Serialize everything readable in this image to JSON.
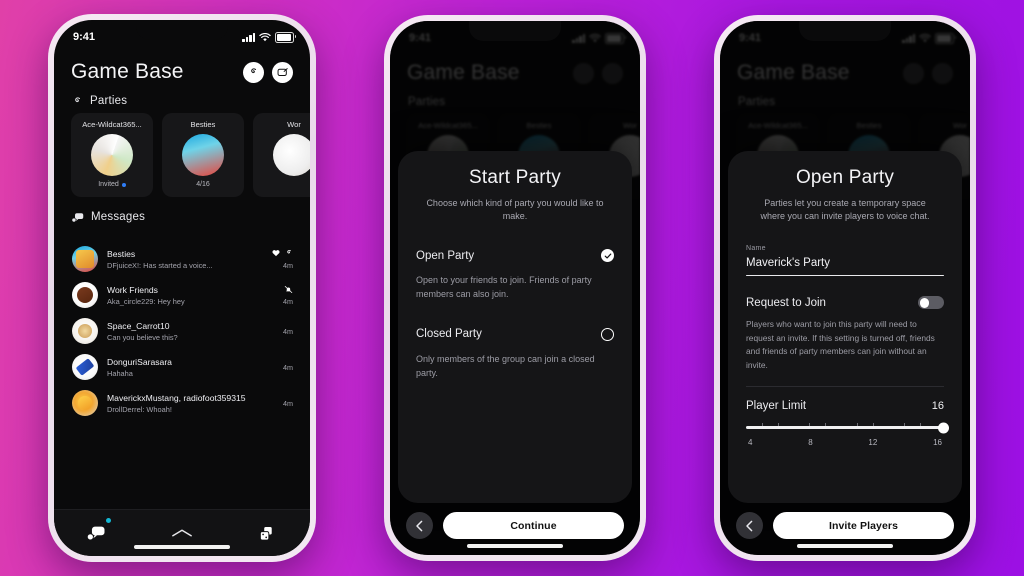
{
  "background": {
    "gradient_from": "#e040a8",
    "gradient_to": "#9c10e4"
  },
  "phones": [
    {
      "id": "phone-home",
      "status_bar": {
        "time": "9:41",
        "cellular_icon": "signal-bars-icon",
        "wifi_icon": "wifi-icon",
        "battery_icon": "battery-icon"
      },
      "header": {
        "title": "Game Base",
        "buttons": [
          {
            "name": "party-icon-button",
            "icon": "party-swirl-icon"
          },
          {
            "name": "new-message-button",
            "icon": "new-message-icon"
          }
        ]
      },
      "parties_section": {
        "icon": "party-swirl-icon",
        "title": "Parties",
        "cards": [
          {
            "name": "Ace-Wildcat365...",
            "status": "Invited",
            "has_dot": true,
            "avatar": "collage-avatar"
          },
          {
            "name": "Besties",
            "status": "4/16",
            "has_dot": false,
            "avatar": "hotdog-avatar"
          },
          {
            "name": "Wor",
            "status": "",
            "has_dot": false,
            "avatar": "dog-avatar"
          }
        ]
      },
      "messages_section": {
        "icon": "chat-bubbles-icon",
        "title": "Messages",
        "rows": [
          {
            "name": "Besties",
            "preview": "DFjuiceX!: Has started a voice...",
            "time": "4m",
            "icons": [
              "heart-icon",
              "party-swirl-icon"
            ],
            "avatar": "hotdog-avatar"
          },
          {
            "name": "Work Friends",
            "preview": "Aka_circle229: Hey hey",
            "time": "4m",
            "icons": [
              "bell-muted-icon"
            ],
            "avatar": "steak-avatar"
          },
          {
            "name": "Space_Carrot10",
            "preview": "Can you believe this?",
            "time": "4m",
            "icons": [],
            "avatar": "cat-avatar"
          },
          {
            "name": "DonguriSarasara",
            "preview": "Hahaha",
            "time": "4m",
            "icons": [],
            "avatar": "skateboard-avatar"
          },
          {
            "name": "MaverickxMustang, radiofoot359315",
            "preview": "DrollDerrel: Whoah!",
            "time": "4m",
            "icons": [],
            "avatar": "chick-avatar"
          }
        ]
      },
      "tab_bar": [
        {
          "name": "tab-messages",
          "icon": "chat-bubbles-icon",
          "badge": true
        },
        {
          "name": "tab-expand",
          "icon": "chevron-up-icon",
          "badge": false
        },
        {
          "name": "tab-games",
          "icon": "dice-icon",
          "badge": false
        }
      ]
    },
    {
      "id": "phone-start-party",
      "status_bar": {
        "time": "9:41",
        "cellular_icon": "signal-bars-icon",
        "wifi_icon": "wifi-icon",
        "battery_icon": "battery-icon"
      },
      "header": {
        "title": "Game Base"
      },
      "parties_section": {
        "title": "Parties",
        "cards": [
          {
            "name": "Ace-Wildcat365..."
          },
          {
            "name": "Besties"
          },
          {
            "name": "Wor"
          }
        ]
      },
      "sheet": {
        "title": "Start Party",
        "subtitle": "Choose which kind of party you would like to make.",
        "options": [
          {
            "label": "Open Party",
            "selected": true,
            "description": "Open to your friends to join. Friends of party members can also join."
          },
          {
            "label": "Closed Party",
            "selected": false,
            "description": "Only members of the group can join a closed party."
          }
        ]
      },
      "footer": {
        "back_icon": "chevron-left-icon",
        "primary_label": "Continue"
      }
    },
    {
      "id": "phone-open-party",
      "status_bar": {
        "time": "9:41",
        "cellular_icon": "signal-bars-icon",
        "wifi_icon": "wifi-icon",
        "battery_icon": "battery-icon"
      },
      "header": {
        "title": "Game Base"
      },
      "parties_section": {
        "title": "Parties",
        "cards": [
          {
            "name": "Ace-Wildcat365..."
          },
          {
            "name": "Besties"
          },
          {
            "name": "Wor"
          }
        ]
      },
      "sheet": {
        "title": "Open Party",
        "subtitle": "Parties let you create a temporary space where you can invite players to voice chat.",
        "name_field": {
          "label": "Name",
          "value": "Maverick's Party"
        },
        "request_to_join": {
          "label": "Request to Join",
          "enabled": false,
          "description": "Players who want to join this party will need to request an invite. If this setting is turned off, friends and friends of party members can join without an invite."
        },
        "player_limit": {
          "label": "Player Limit",
          "value": "16",
          "ticks": [
            "4",
            "8",
            "12",
            "16"
          ],
          "min": 1,
          "max": 16,
          "current": 16
        }
      },
      "footer": {
        "back_icon": "chevron-left-icon",
        "primary_label": "Invite Players"
      }
    }
  ]
}
